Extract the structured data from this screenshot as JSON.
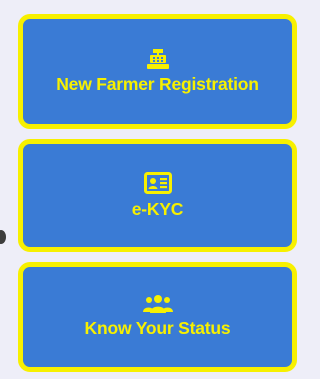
{
  "menu": {
    "items": [
      {
        "label": "New Farmer Registration",
        "icon": "cash-register-icon"
      },
      {
        "label": "e-KYC",
        "icon": "id-card-icon"
      },
      {
        "label": "Know Your Status",
        "icon": "users-group-icon"
      }
    ]
  },
  "colors": {
    "background": "#eeeef8",
    "card_fill": "#3a7bd5",
    "card_border": "#f7f000",
    "text": "#f7f000"
  }
}
